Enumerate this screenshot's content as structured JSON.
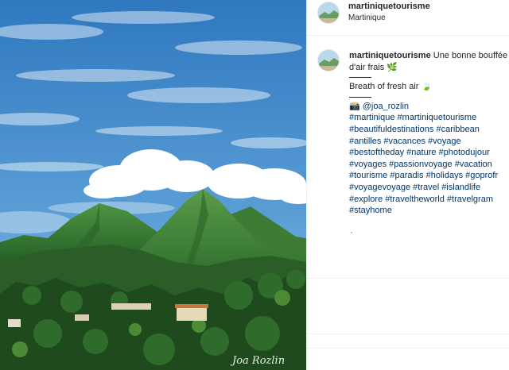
{
  "post": {
    "username": "martiniquetourisme",
    "location": "Martinique",
    "caption": {
      "username": "martiniquetourisme",
      "line1": "Une bonne bouffée d'air frais 🌿",
      "line2": "Breath of fresh air 🍃",
      "credit": "📸 @joa_rozlin",
      "hashtags": "#martinique #martiniquetourisme #beautifuldestinations #caribbean #antilles #vacances #voyage #bestoftheday #nature #photodujour #voyages #passionvoyage #vacation #tourisme #paradis #holidays #goprofr #voyagevoyage #travel #islandlife #explore #traveltheworld #travelgram #stayhome"
    },
    "watermark": "Joa Rozlin"
  },
  "colors": {
    "sky_top": "#3f86c7",
    "sky_bottom": "#8cc0e3",
    "mountain": "#3f7e3a",
    "forest": "#1f4a1f",
    "text": "#262626",
    "link": "#00376b"
  }
}
